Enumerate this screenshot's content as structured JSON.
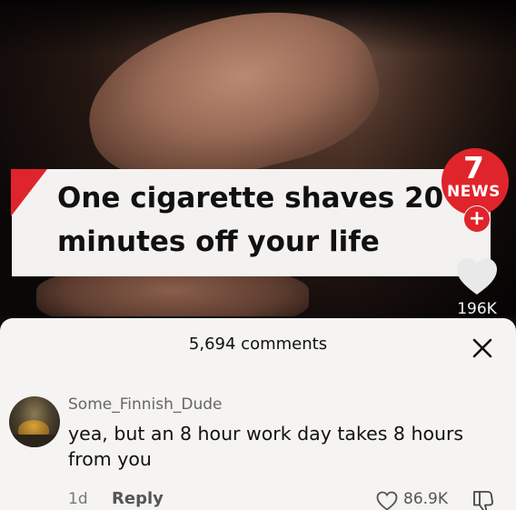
{
  "video": {
    "headline_line1": "One cigarette shaves 20",
    "headline_line2": "minutes off your life",
    "logo_number": "7",
    "logo_word": "NEWS",
    "follow_symbol": "+",
    "like_count": "196K",
    "accent_color": "#e0242b"
  },
  "comments_sheet": {
    "count_label": "5,694 comments",
    "close_icon": "close-icon"
  },
  "comment": {
    "username": "Some_Finnish_Dude",
    "text": "yea, but an 8 hour work day takes 8 hours from you",
    "time": "1d",
    "reply_label": "Reply",
    "likes": "86.9K",
    "icons": [
      "heart-outline-icon",
      "dislike-icon"
    ]
  }
}
